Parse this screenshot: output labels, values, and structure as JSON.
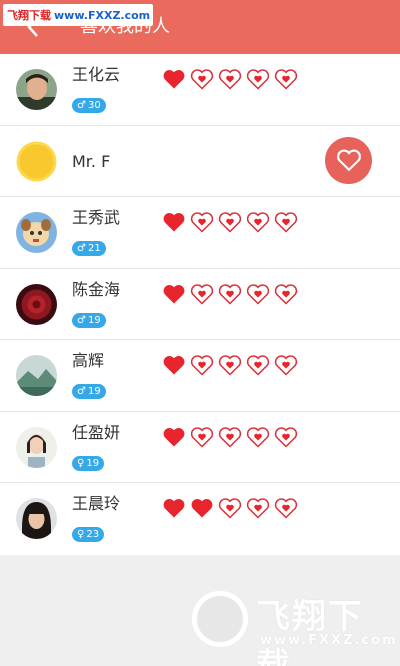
{
  "header": {
    "title": "喜欢我的人",
    "back_icon": "chevron-left-icon",
    "background": "#ea6a5e"
  },
  "watermark_top": {
    "cn": "飞翔下载",
    "url": "www.FXXZ.com"
  },
  "people": [
    {
      "name": "王化云",
      "gender": "male",
      "gender_symbol": "♂",
      "age": "30",
      "rating": 1,
      "avatar": "photo-man"
    },
    {
      "name": "Mr. F",
      "avatar": "yellow-circle",
      "has_like_button": true
    },
    {
      "name": "王秀武",
      "gender": "male",
      "gender_symbol": "♂",
      "age": "21",
      "rating": 1,
      "avatar": "cartoon-dog"
    },
    {
      "name": "陈金海",
      "gender": "male",
      "gender_symbol": "♂",
      "age": "19",
      "rating": 1,
      "avatar": "red-flower"
    },
    {
      "name": "高辉",
      "gender": "male",
      "gender_symbol": "♂",
      "age": "19",
      "rating": 1,
      "avatar": "landscape"
    },
    {
      "name": "任盈妍",
      "gender": "female",
      "gender_symbol": "♀",
      "age": "19",
      "rating": 1,
      "avatar": "photo-woman"
    },
    {
      "name": "王晨玲",
      "gender": "female",
      "gender_symbol": "♀",
      "age": "23",
      "rating": 2,
      "avatar": "photo-girl"
    }
  ],
  "max_rating": 5,
  "colors": {
    "heart": "#e8242c",
    "badge": "#35a9e8",
    "like_button": "#e6625a"
  },
  "watermark_bottom": {
    "cn": "飞翔下载",
    "url": "www.FXXZ.com"
  }
}
